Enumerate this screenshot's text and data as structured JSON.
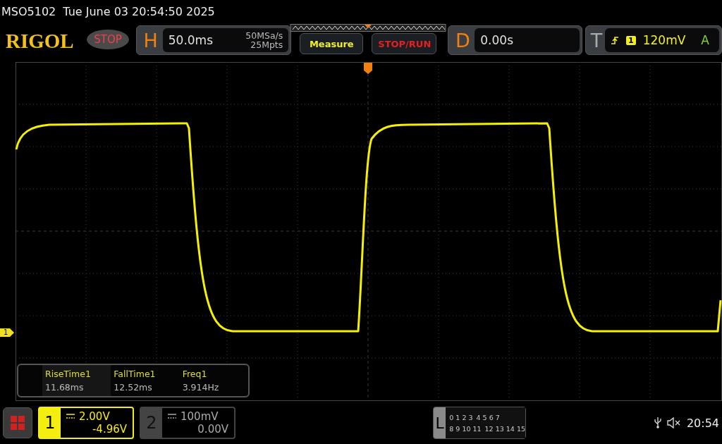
{
  "status_line": {
    "model": "MSO5102",
    "datetime": "Tue June 03 20:54:50 2025"
  },
  "header": {
    "logo": "RIGOL",
    "run_state": "STOP",
    "horizontal": {
      "label": "H",
      "timebase": "50.0ms",
      "sample_rate": "50MSa/s",
      "memory_depth": "25Mpts"
    },
    "buttons": [
      "Measure",
      "STOP/RUN"
    ],
    "delay": {
      "label": "D",
      "value": "0.00s"
    },
    "trigger": {
      "label": "T",
      "source": "1",
      "level": "120mV",
      "mode": "A"
    }
  },
  "channel_marker": "1",
  "measurements": [
    {
      "name": "RiseTime1",
      "value": "11.68ms"
    },
    {
      "name": "FallTime1",
      "value": "12.52ms"
    },
    {
      "name": "Freq1",
      "value": "3.914Hz"
    }
  ],
  "channels": [
    {
      "number": "1",
      "scale": "2.00V",
      "offset": "-4.96V",
      "selected": true
    },
    {
      "number": "2",
      "scale": "100mV",
      "offset": "0.00V",
      "selected": false
    }
  ],
  "logic": {
    "label": "L",
    "rows": [
      [
        "0 1 2 3",
        "4 5 6 7"
      ],
      [
        "8 9 10 11",
        "12 13 14 15"
      ]
    ]
  },
  "clock": "20:54"
}
